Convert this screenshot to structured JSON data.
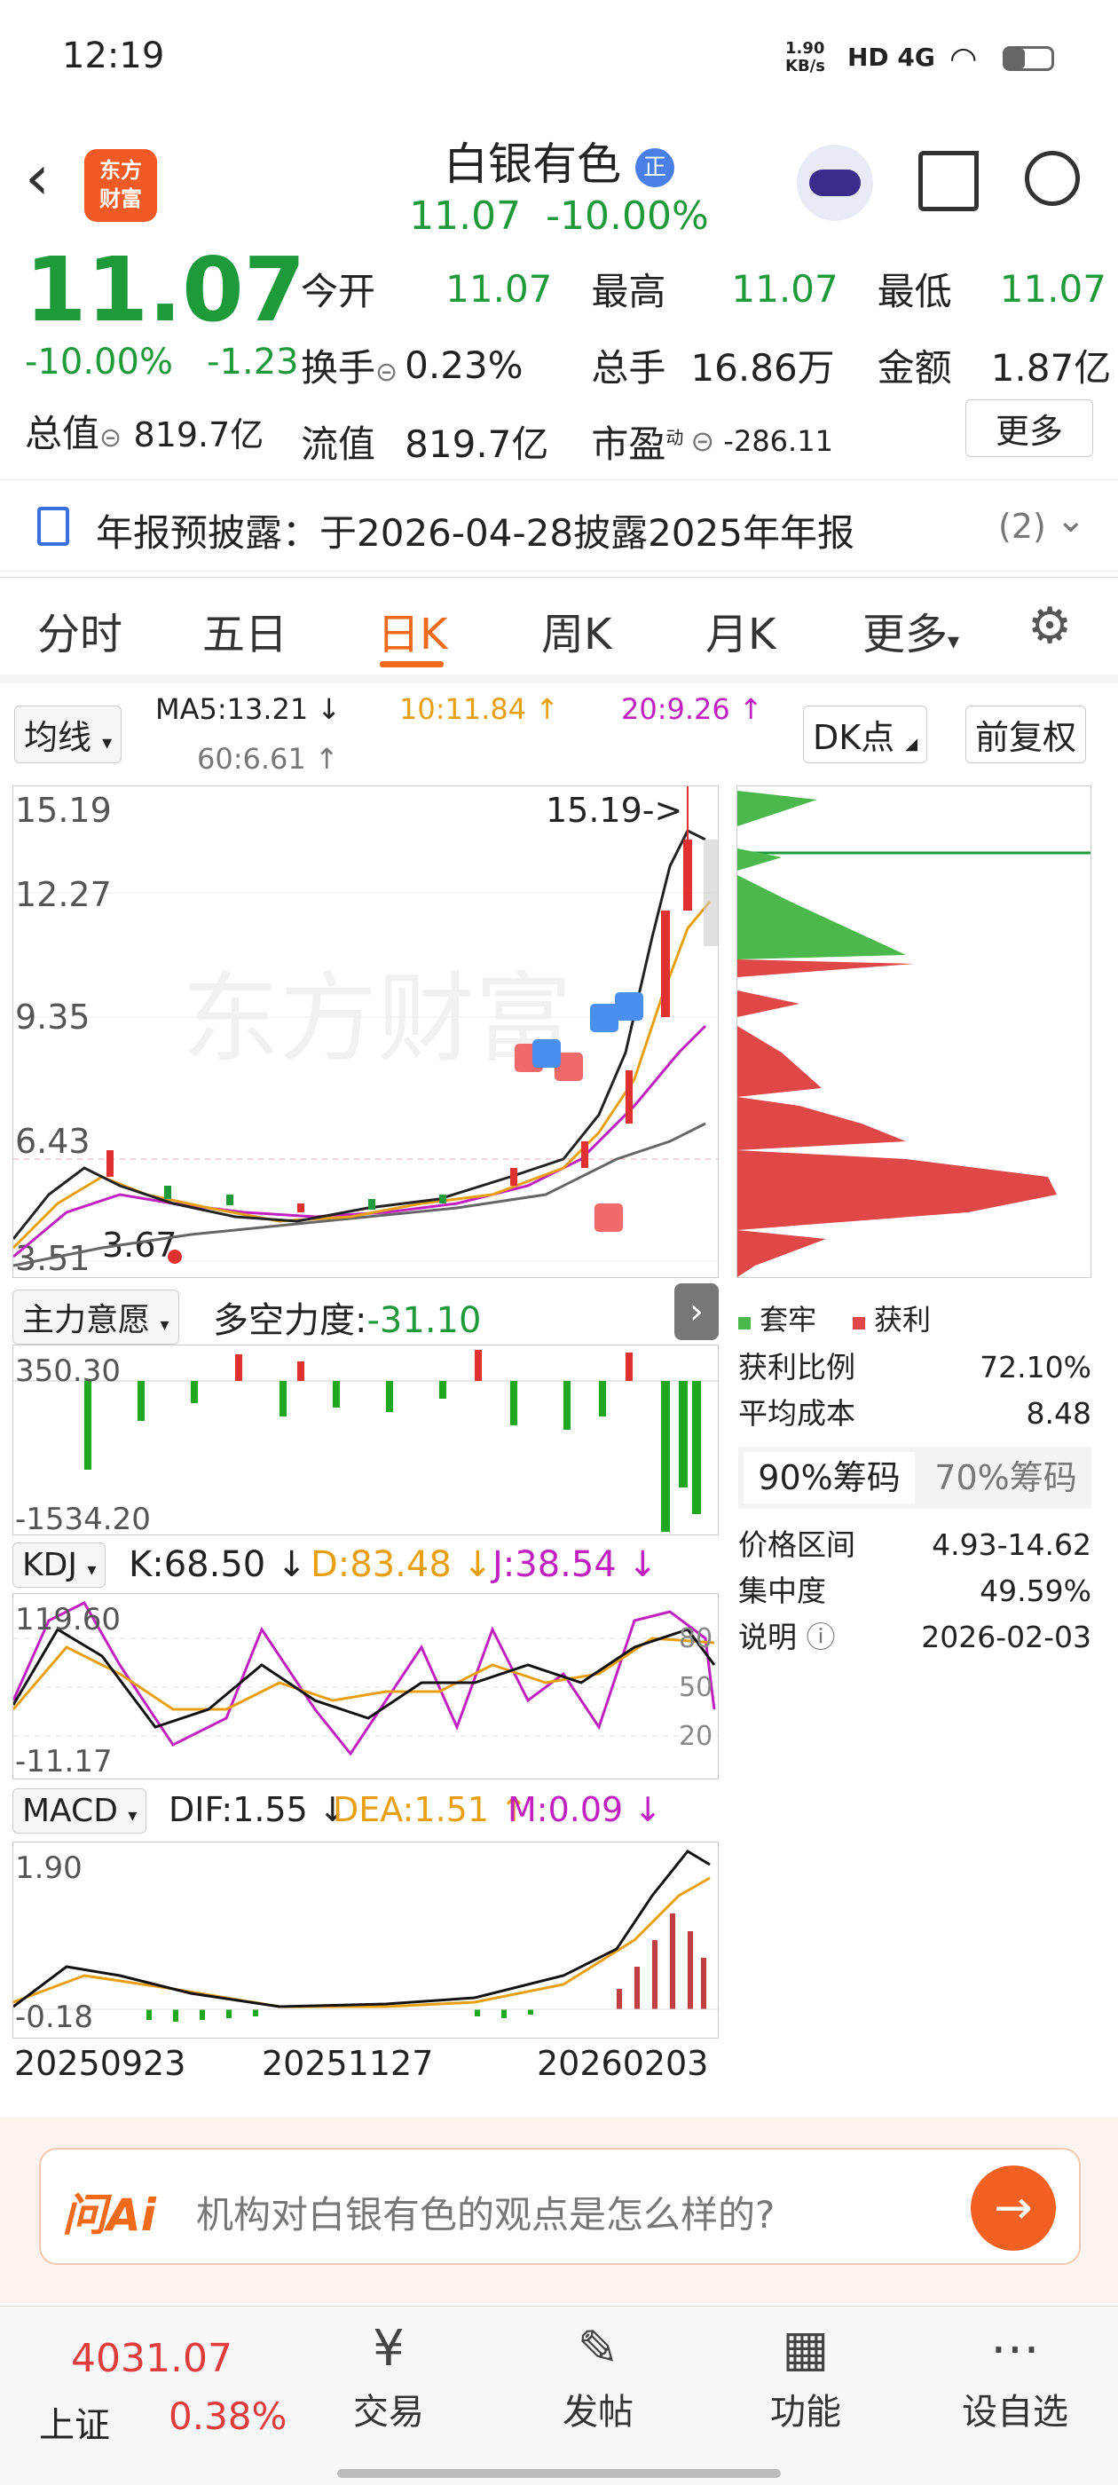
{
  "status": {
    "time": "12:19",
    "speed": "1.90\nKB/s",
    "net": "HD 4G"
  },
  "header": {
    "logo_line1": "东方",
    "logo_line2": "财富",
    "title": "白银有色",
    "badge": "正",
    "price": "11.07",
    "change_pct": "-10.00%"
  },
  "quote": {
    "price": "11.07",
    "pct": "-10.00%",
    "chg": "-1.23",
    "open_label": "今开",
    "open": "11.07",
    "high_label": "最高",
    "high": "11.07",
    "low_label": "最低",
    "low": "11.07",
    "turnover_label": "换手",
    "turnover": "0.23%",
    "volume_label": "总手",
    "volume": "16.86万",
    "amount_label": "金额",
    "amount": "1.87亿",
    "mktcap_label": "总值",
    "mktcap": "819.7亿",
    "float_label": "流值",
    "float": "819.7亿",
    "pe_label": "市盈",
    "pe_sup": "动",
    "pe": "-286.11",
    "more_button": "更多"
  },
  "notice": {
    "text": "年报预披露：于2026-04-28披露2025年年报",
    "count": "(2)"
  },
  "tabs": [
    "分时",
    "五日",
    "日K",
    "周K",
    "月K",
    "更多"
  ],
  "kline": {
    "ma_button": "均线",
    "ma5": "MA5:13.21 ↓",
    "ma10": "10:11.84 ↑",
    "ma20": "20:9.26 ↑",
    "ma60": "60:6.61 ↑",
    "dk_button": "DK点",
    "adjust_button": "前复权",
    "y_labels": [
      "15.19",
      "12.27",
      "9.35",
      "6.43",
      "3.51"
    ],
    "max_marker": "15.19->",
    "min_marker": "3.67",
    "watermark": "东方财富"
  },
  "chips": {
    "legend_trapped": "套牢",
    "legend_profit": "获利",
    "profit_ratio_label": "获利比例",
    "profit_ratio": "72.10%",
    "avg_cost_label": "平均成本",
    "avg_cost": "8.48",
    "tab90": "90%筹码",
    "tab70": "70%筹码",
    "range_label": "价格区间",
    "range": "4.93-14.62",
    "concentration_label": "集中度",
    "concentration": "49.59%",
    "note_label": "说明",
    "note_date": "2026-02-03"
  },
  "main_force": {
    "button": "主力意愿",
    "label": "多空力度:",
    "value": "-31.10",
    "y_top": "350.30",
    "y_bottom": "-1534.20"
  },
  "kdj": {
    "button": "KDJ",
    "k": "K:68.50 ↓",
    "d": "D:83.48 ↓",
    "j": "J:38.54 ↓",
    "y_top": "119.60",
    "y_bottom": "-11.17",
    "levels": [
      "80",
      "50",
      "20"
    ]
  },
  "macd": {
    "button": "MACD",
    "dif": "DIF:1.55 ↓",
    "dea": "DEA:1.51 ↑",
    "m": "M:0.09 ↓",
    "y_top": "1.90",
    "y_bottom": "-0.18"
  },
  "x_dates": [
    "20250923",
    "20251127",
    "20260203"
  ],
  "ai": {
    "logo": "问Ai",
    "placeholder": "机构对白银有色的观点是怎么样的?"
  },
  "nav": {
    "index_value": "4031.07",
    "index_name": "上证",
    "index_pct": "0.38%",
    "items": [
      "交易",
      "发帖",
      "功能",
      "设自选"
    ]
  }
}
